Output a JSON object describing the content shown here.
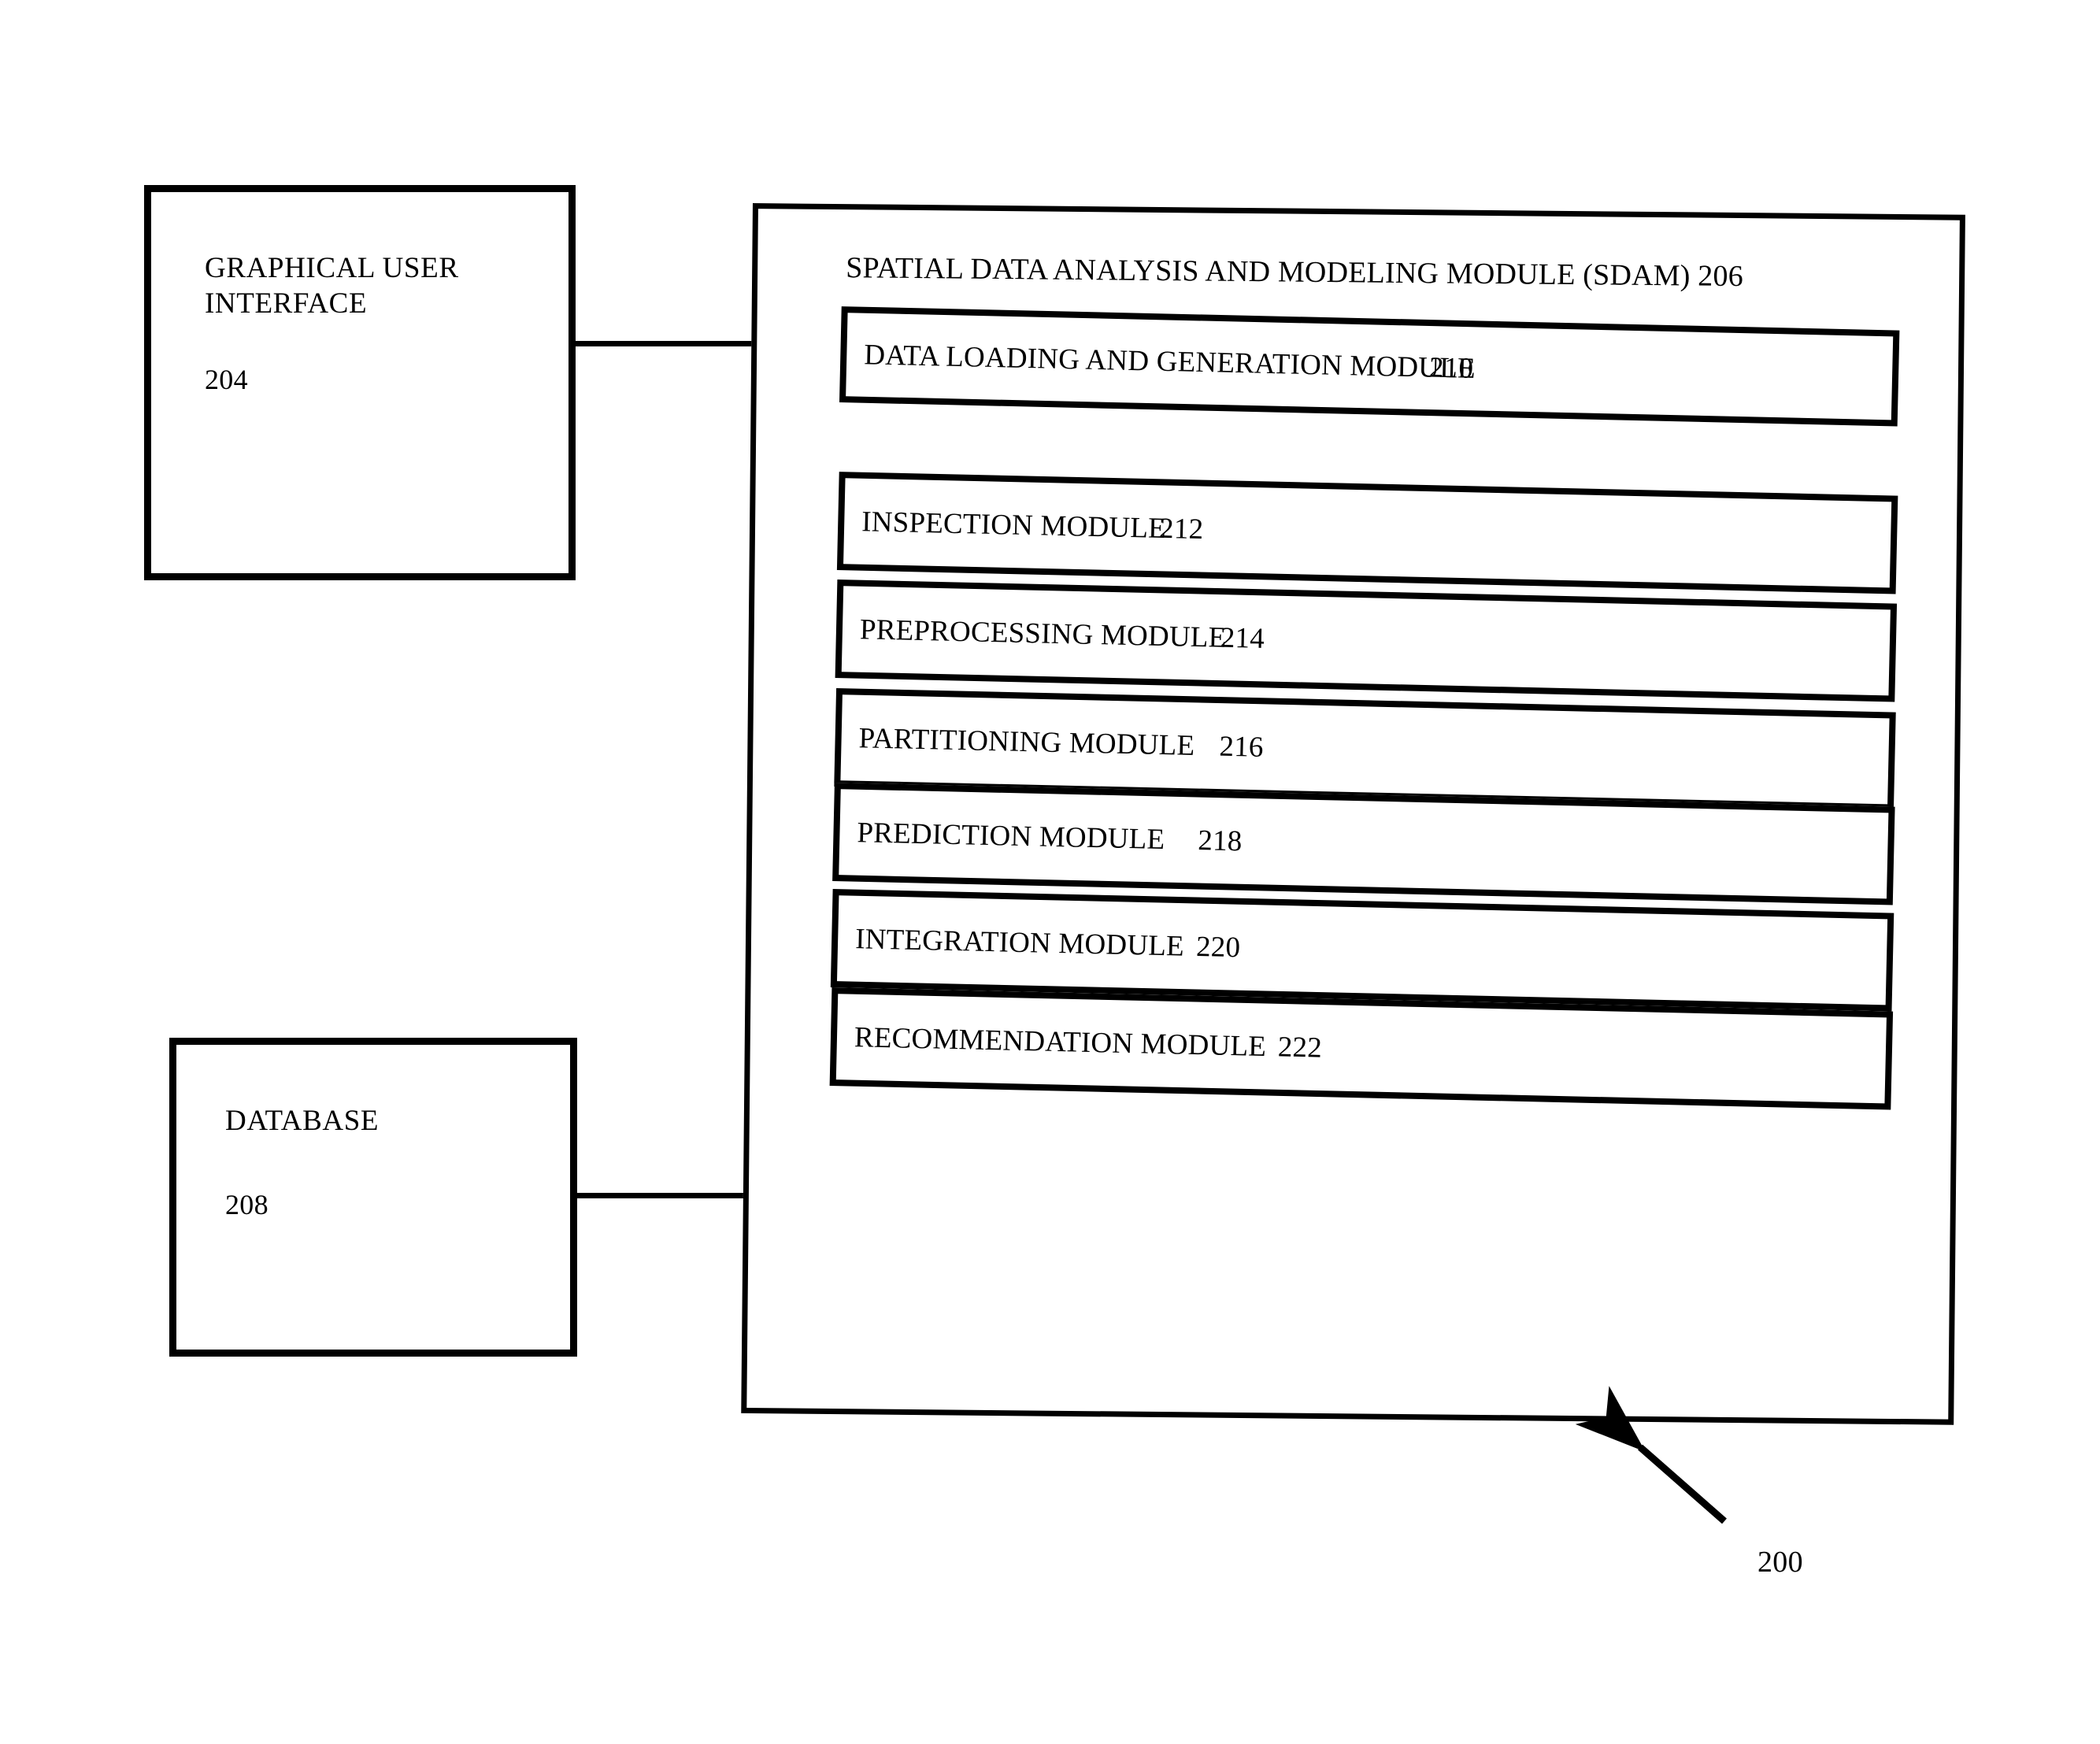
{
  "figure": {
    "reference_numeral": "200",
    "nodes": {
      "gui": {
        "label_line1": "GRAPHICAL USER",
        "label_line2": "INTERFACE",
        "numeral": "204"
      },
      "database": {
        "label": "DATABASE",
        "numeral": "208"
      },
      "sdam": {
        "header": "SPATIAL DATA ANALYSIS AND MODELING MODULE (SDAM) 206",
        "numeral": "206",
        "modules": [
          {
            "name": "DATA LOADING AND GENERATION MODULE",
            "numeral": "210"
          },
          {
            "name": "INSPECTION MODULE",
            "numeral": "212"
          },
          {
            "name": "PREPROCESSING MODULE",
            "numeral": "214"
          },
          {
            "name": "PARTITIONING MODULE",
            "numeral": "216"
          },
          {
            "name": "PREDICTION MODULE",
            "numeral": "218"
          },
          {
            "name": "INTEGRATION MODULE",
            "numeral": "220"
          },
          {
            "name": "RECOMMENDATION MODULE",
            "numeral": "222"
          }
        ]
      }
    },
    "connectors": [
      {
        "from": "gui",
        "to": "sdam"
      },
      {
        "from": "database",
        "to": "sdam"
      }
    ],
    "callout_arrow": {
      "points_to": "sdam-outer-box",
      "label": "200"
    },
    "colors": {
      "ink": "#000000",
      "paper": "#ffffff"
    }
  }
}
